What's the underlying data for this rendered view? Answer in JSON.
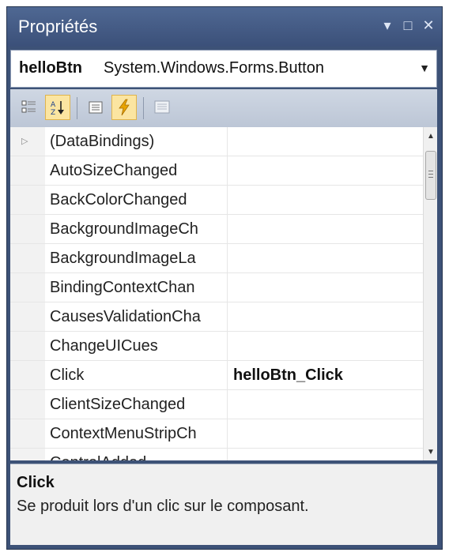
{
  "window": {
    "title": "Propriétés"
  },
  "title_controls": [
    {
      "name": "dropdown-menu-icon",
      "glyph": "▾"
    },
    {
      "name": "maximize-icon",
      "glyph": "□"
    },
    {
      "name": "close-icon",
      "glyph": "✕"
    }
  ],
  "object_selector": {
    "name": "helloBtn",
    "type": "System.Windows.Forms.Button",
    "arrow": "▼"
  },
  "toolbar": {
    "buttons": [
      {
        "name": "categorized-button",
        "icon": "categorized-icon",
        "active": false
      },
      {
        "name": "alphabetical-button",
        "icon": "sort-az-icon",
        "active": true
      },
      {
        "name": "properties-button",
        "icon": "properties-list-icon",
        "active": false
      },
      {
        "name": "events-button",
        "icon": "lightning-icon",
        "active": true
      },
      {
        "name": "property-pages-button",
        "icon": "property-pages-icon",
        "active": false
      }
    ]
  },
  "grid": {
    "rows": [
      {
        "name": "(DataBindings)",
        "value": "",
        "expandable": true
      },
      {
        "name": "AutoSizeChanged",
        "value": ""
      },
      {
        "name": "BackColorChanged",
        "value": ""
      },
      {
        "name": "BackgroundImageCh",
        "value": ""
      },
      {
        "name": "BackgroundImageLa",
        "value": ""
      },
      {
        "name": "BindingContextChan",
        "value": ""
      },
      {
        "name": "CausesValidationCha",
        "value": ""
      },
      {
        "name": "ChangeUICues",
        "value": ""
      },
      {
        "name": "Click",
        "value": "helloBtn_Click"
      },
      {
        "name": "ClientSizeChanged",
        "value": ""
      },
      {
        "name": "ContextMenuStripCh",
        "value": ""
      },
      {
        "name": "ControlAdded",
        "value": ""
      }
    ],
    "expander_glyph": "▷"
  },
  "scrollbar": {
    "up": "▲",
    "down": "▼"
  },
  "description": {
    "title": "Click",
    "text": "Se produit lors d'un clic sur le composant."
  },
  "colors": {
    "title_bar": "#3d5277",
    "toolbar": "#c8d1df",
    "active_button": "#fbe5a1",
    "lightning": "#e8a400"
  }
}
